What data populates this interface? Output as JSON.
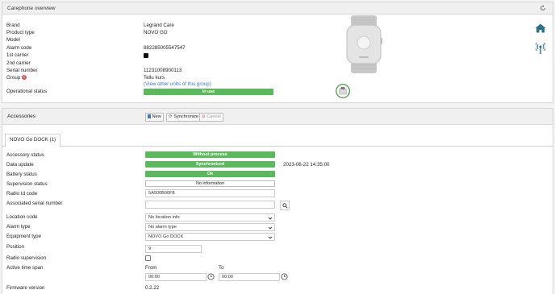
{
  "overview": {
    "title": "Carephone overview",
    "fields": [
      {
        "label": "Brand",
        "value": "Legrand Care"
      },
      {
        "label": "Product type",
        "value": "NOVO GO"
      },
      {
        "label": "Model",
        "value": ""
      },
      {
        "label": "Alarm code",
        "value": "882285005547547"
      },
      {
        "label": "1st carrier",
        "value": ""
      },
      {
        "label": "2nd carrier",
        "value": ""
      },
      {
        "label": "Serial number",
        "value": "11231008900113"
      },
      {
        "label": "Group",
        "value": "Tellu kurs"
      }
    ],
    "group_link": "(View other units of this group)",
    "operational_status_label": "Operational status",
    "operational_status_value": "In use",
    "accent_green": "#5cb85c"
  },
  "accessories": {
    "title": "Accessories",
    "new_label": "New",
    "sync_label": "Synchronize",
    "cancel_label": "Cancel",
    "tab_label": "NOVO Go DOCK (1)",
    "accessory_status_label": "Accessory status",
    "accessory_status_value": "Without process",
    "data_update_label": "Data update",
    "data_update_value": "Synchronized",
    "data_update_time": "2023-06-22 14:35:00",
    "battery_label": "Battery status",
    "battery_value": "Ok",
    "supervision_label": "Supervision status",
    "supervision_value": "No information",
    "radio_id_label": "Radio Id code",
    "radio_id_value": "5A500B00F8",
    "assoc_serial_label": "Associated serial number",
    "location_label": "Location code",
    "location_value": "No location info",
    "alarm_type_label": "Alarm type",
    "alarm_type_value": "No alarm type",
    "equipment_label": "Equipment type",
    "equipment_value": "NOVO Go DOCK",
    "position_label": "Position",
    "position_value": "9",
    "radio_supervision_label": "Radio supervision",
    "active_span_label": "Active time span",
    "from_label": "From",
    "to_label": "To",
    "from_value": "00:00",
    "to_value": "00:00",
    "firmware_label": "Firmware version",
    "firmware_value": "0.2.22"
  }
}
